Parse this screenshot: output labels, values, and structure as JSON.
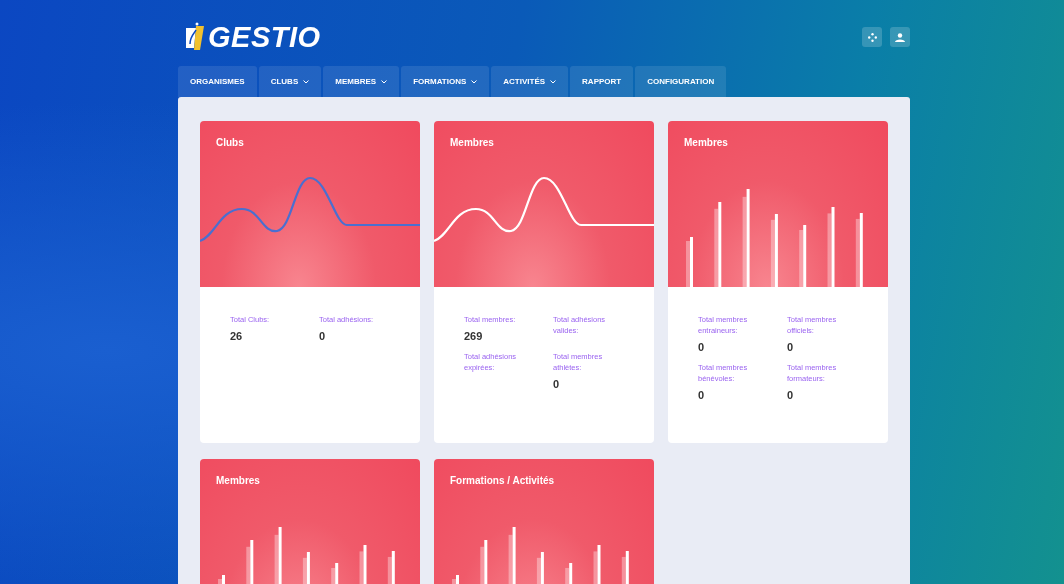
{
  "logo": {
    "text": "GESTIO"
  },
  "nav": [
    {
      "label": "ORGANISMES",
      "dropdown": false
    },
    {
      "label": "CLUBS",
      "dropdown": true
    },
    {
      "label": "MEMBRES",
      "dropdown": true
    },
    {
      "label": "FORMATIONS",
      "dropdown": true
    },
    {
      "label": "ACTIVITÉS",
      "dropdown": true
    },
    {
      "label": "RAPPORT",
      "dropdown": false
    },
    {
      "label": "CONFIGURATION",
      "dropdown": false
    }
  ],
  "cards": [
    {
      "title": "Clubs",
      "kind": "line",
      "color": "#4a6fd0",
      "stats": [
        {
          "label": "Total Clubs:",
          "value": "26"
        },
        {
          "label": "Total adhésions:",
          "value": "0"
        }
      ]
    },
    {
      "title": "Membres",
      "kind": "line",
      "color": "#ffffff",
      "stats": [
        {
          "label": "Total membres:",
          "value": "269"
        },
        {
          "label": "Total adhésions valides:"
        },
        {
          "label": "Total adhésions expirées:"
        },
        {
          "label": "Total membres athlètes:",
          "value": "0"
        }
      ]
    },
    {
      "title": "Membres",
      "kind": "bars",
      "stats": [
        {
          "label": "Total membres entraineurs:",
          "value": "0"
        },
        {
          "label": "Total membres officiels:",
          "value": "0"
        },
        {
          "label": "Total membres bénévoles:",
          "value": "0"
        },
        {
          "label": "Total membres formateurs:",
          "value": "0"
        }
      ]
    },
    {
      "title": "Membres",
      "kind": "bars"
    },
    {
      "title": "Formations / Activités",
      "kind": "bars"
    }
  ]
}
